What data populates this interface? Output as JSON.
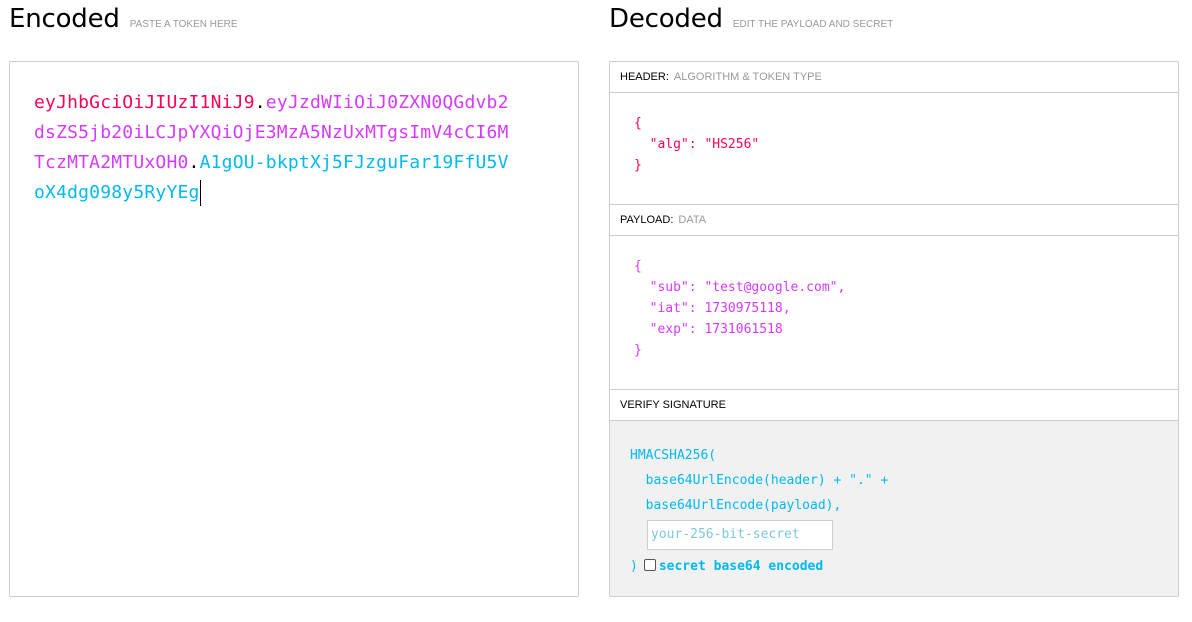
{
  "encoded": {
    "title": "Encoded",
    "subtitle": "PASTE A TOKEN HERE",
    "token": {
      "header": "eyJhbGciOiJIUzI1NiJ9",
      "payload": "eyJzdWIiOiJ0ZXN0QGdvb2dsZS5jb20iLCJpYXQiOjE3MzA5NzUxMTgsImV4cCI6MTczMTA2MTUxOH0",
      "signature": "A1gOU-bkptXj5FJzguFar19FfU5VoX4dg098y5RyYEg",
      "dot": "."
    }
  },
  "decoded": {
    "title": "Decoded",
    "subtitle": "EDIT THE PAYLOAD AND SECRET",
    "header_section": {
      "label": "HEADER:",
      "sublabel": "ALGORITHM & TOKEN TYPE",
      "lines": [
        "{",
        "  \"alg\": \"HS256\"",
        "}"
      ]
    },
    "payload_section": {
      "label": "PAYLOAD:",
      "sublabel": "DATA",
      "lines": [
        "{",
        "  \"sub\": \"test@google.com\",",
        "  \"iat\": 1730975118,",
        "  \"exp\": 1731061518",
        "}"
      ]
    },
    "verify_section": {
      "label": "VERIFY SIGNATURE",
      "fn_open": "HMACSHA256(",
      "line1": "  base64UrlEncode(header) + \".\" +",
      "line2": "  base64UrlEncode(payload),",
      "secret_placeholder": "your-256-bit-secret",
      "close": ")",
      "checkbox_label": "secret base64 encoded"
    }
  },
  "colors": {
    "header": "#fb015b",
    "payload": "#d63aff",
    "signature": "#00b9f1"
  }
}
